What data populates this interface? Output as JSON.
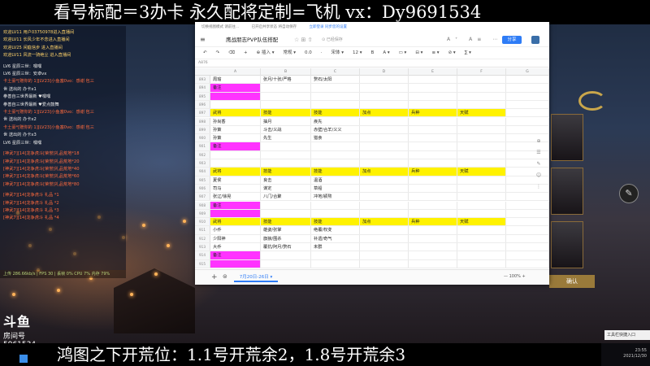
{
  "banners": {
    "top": "看号标配＝3办卡 永久配将定制=飞机 vx：Dy9691534",
    "bottom": "鸿图之下开荒位：1.1号开荒余2，1.8号开荒余3"
  },
  "chat": {
    "lines": [
      {
        "t": "欢迎LV11 用户03750978进入直播间",
        "k": "sys"
      },
      {
        "t": "欢迎LV11 长风少年不念进入直播间",
        "k": "sys"
      },
      {
        "t": "欢迎LV25 闲庭信步 进入直播间",
        "k": "sys"
      },
      {
        "t": "欢迎LV11 风流一骑绝尘 进入直播间",
        "k": "sys"
      },
      {
        "t": "",
        "k": "div"
      },
      {
        "t": "LV6 星辰三世：嘿嘿",
        "k": "n"
      },
      {
        "t": "LV6 星辰三世：安卓vx",
        "k": "n"
      },
      {
        "t": "卡土豪*[赠你的 1][LV23]小鱼塞0vo：感谢 包三",
        "k": "gift"
      },
      {
        "t": "世 送出的 办卡x1",
        "k": "n"
      },
      {
        "t": "拳善自三世界最新 ♥嘿嘿",
        "k": "n"
      },
      {
        "t": "拳善自三世界最新 ♥爱点鼓舞",
        "k": "n"
      },
      {
        "t": "卡土豪*[赠你的 1][LV23]小鱼塞0vo：感谢 包三",
        "k": "gift"
      },
      {
        "t": "世 送出的 办卡x2",
        "k": "n"
      },
      {
        "t": "卡土豪*[赠你的 1][LV23]小鱼塞0vo：感谢 包三",
        "k": "gift"
      },
      {
        "t": "世 送出的 办卡x3",
        "k": "n"
      },
      {
        "t": "LV6 星辰三世：嘿嘿",
        "k": "n"
      },
      {
        "t": "",
        "k": "div"
      },
      {
        "t": "[神武7][14]龙争虎斗[荣誉]礼品荒地*18",
        "k": "gift"
      },
      {
        "t": "[神武7][14]龙争虎斗[荣誉]礼品荒地*20",
        "k": "gift"
      },
      {
        "t": "[神武7][14]龙争虎斗[荣誉]礼品荒地*40",
        "k": "gift"
      },
      {
        "t": "[神武7][14]龙争虎斗[荣誉]礼品荒地*60",
        "k": "gift"
      },
      {
        "t": "[神武7][14]龙争虎斗[荣誉]礼品荒地*80",
        "k": "gift"
      },
      {
        "t": "",
        "k": "div"
      },
      {
        "t": "[神武7][14]龙争虎斗 礼品 *1",
        "k": "gift"
      },
      {
        "t": "[神武7][14]龙争虎斗 礼品 *2",
        "k": "gift"
      },
      {
        "t": "[神武7][14]龙争虎斗 礼品 *3",
        "k": "gift"
      },
      {
        "t": "[神武7][14]龙争虎斗 礼品 *4",
        "k": "gift"
      }
    ],
    "status": "上传 286.66kb/s | FPS 30 | 丢帧 0%    CPU 7%  内存 79%"
  },
  "logo": {
    "name": "斗鱼",
    "sub": "房间号",
    "room": "5961534"
  },
  "window": {
    "notices": [
      "切换视图模式 请前往...",
      "已开启共享状态 将自动保存",
      "立即登录 同步您的设置"
    ],
    "menu_icon": "≡",
    "title": "鹰战朋志PVP队伍搭配",
    "star": "☆ ⊞ ⇧",
    "saved": "⊙ 已经保存",
    "title_icons": "A⁺ A≡ ⋯",
    "share": "分享",
    "toolbar": [
      "↶",
      "↷",
      "⌫",
      "+",
      "⊕ 插入 ▾",
      "常规 ▾",
      "0.0",
      "·",
      "宋体 ▾",
      "12 ▾",
      "B",
      "A ▾",
      "▭ ▾",
      "⊟ ▾",
      "≡ ▾",
      "⊘ ▾",
      "∑ ▾"
    ],
    "cell_ref": "A876",
    "columns": [
      "A",
      "B",
      "C",
      "D",
      "E",
      "F",
      "G"
    ],
    "sheet_tab": "7月20日-26日 ▾",
    "zoom": "— 100% +",
    "side_icons": [
      "⊕",
      "☰",
      "✎",
      "☺",
      "⋮"
    ]
  },
  "rows": [
    {
      "n": "893",
      "y": false,
      "c": [
        "周瑜",
        "张月/十张/严格",
        "赘石/太阳",
        "",
        "",
        ""
      ]
    },
    {
      "n": "894",
      "y": false,
      "c": [
        "备注",
        "",
        "",
        "",
        "",
        ""
      ],
      "pinkA": true
    },
    {
      "n": "895",
      "y": false,
      "c": [
        "",
        "",
        "",
        "",
        "",
        ""
      ],
      "pinkA": true
    },
    {
      "n": "896",
      "y": false,
      "c": [
        "",
        "",
        "",
        "",
        "",
        ""
      ]
    },
    {
      "n": "897",
      "y": true,
      "c": [
        "武将",
        "技能",
        "技能",
        "加点",
        "兵种",
        "天赋"
      ]
    },
    {
      "n": "898",
      "y": false,
      "c": [
        "孙尚香",
        "抽月",
        "疾先",
        "",
        "",
        ""
      ]
    },
    {
      "n": "899",
      "y": false,
      "c": [
        "孙策",
        "斗击/义战",
        "赤壁/合羊/义义",
        "",
        "",
        ""
      ]
    },
    {
      "n": "900",
      "y": false,
      "c": [
        "孙策",
        "先生",
        "猎食",
        "",
        "",
        ""
      ]
    },
    {
      "n": "901",
      "y": false,
      "c": [
        "备注",
        "",
        "",
        "",
        "",
        ""
      ],
      "pinkA": true
    },
    {
      "n": "902",
      "y": false,
      "c": [
        "",
        "",
        "",
        "",
        "",
        ""
      ]
    },
    {
      "n": "903",
      "y": false,
      "c": [
        "",
        "",
        "",
        "",
        "",
        ""
      ]
    },
    {
      "n": "904",
      "y": true,
      "c": [
        "武将",
        "技能",
        "技能",
        "加点",
        "兵种",
        "天赋"
      ]
    },
    {
      "n": "905",
      "y": false,
      "c": [
        "夏侯",
        "良击",
        "温酒",
        "",
        "",
        ""
      ]
    },
    {
      "n": "906",
      "y": false,
      "c": [
        "司马",
        "谋定",
        "草船",
        "",
        "",
        ""
      ]
    },
    {
      "n": "907",
      "y": false,
      "c": [
        "张辽/徐晃",
        "八门/合聚",
        "冲地/颍熬",
        "",
        "",
        ""
      ]
    },
    {
      "n": "908",
      "y": false,
      "c": [
        "备注",
        "",
        "",
        "",
        "",
        ""
      ],
      "pinkA": true
    },
    {
      "n": "909",
      "y": false,
      "c": [
        "",
        "",
        "",
        "",
        "",
        ""
      ],
      "pinkA": true
    },
    {
      "n": "910",
      "y": true,
      "c": [
        "武将",
        "技能",
        "技能",
        "加点",
        "兵种",
        "天赋"
      ],
      "offB": true
    },
    {
      "n": "911",
      "y": false,
      "c": [
        "小乔",
        "雄姿/张掌",
        "绝覆/权变",
        "",
        "",
        ""
      ]
    },
    {
      "n": "912",
      "y": false,
      "c": [
        "少阳神",
        "旗狼/围杀",
        "补遗/奇气",
        "",
        "",
        ""
      ]
    },
    {
      "n": "913",
      "y": false,
      "c": [
        "大乔",
        "覆抗/阿月/赘石",
        "未群",
        "",
        "",
        ""
      ]
    },
    {
      "n": "914",
      "y": false,
      "c": [
        "备注",
        "",
        "",
        "",
        "",
        ""
      ],
      "pinkA": true
    },
    {
      "n": "915",
      "y": false,
      "c": [
        "",
        "",
        "",
        "",
        "",
        ""
      ],
      "pinkA": true
    }
  ],
  "game_ui": {
    "confirm": "确认",
    "round_btn": "✎"
  },
  "tray": {
    "tip": "工具栏快捷入口",
    "time": "23:55",
    "date": "2021/12/30"
  }
}
